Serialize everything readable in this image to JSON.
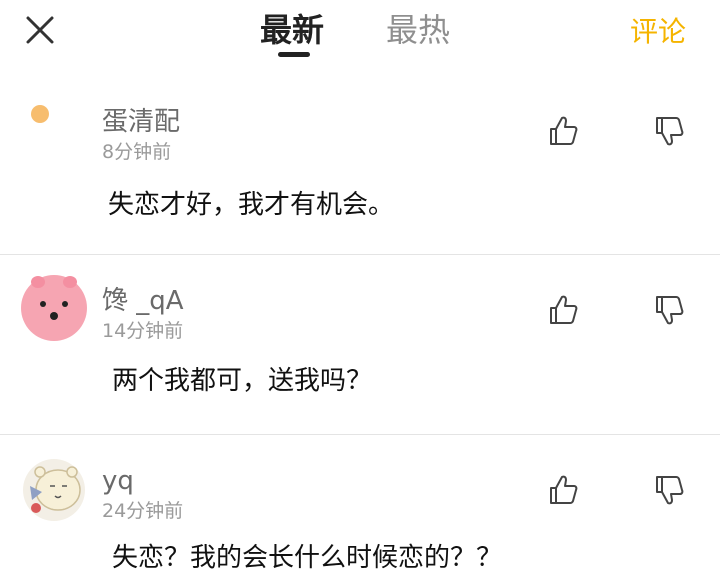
{
  "header": {
    "tabs": [
      {
        "label": "最新",
        "active": true
      },
      {
        "label": "最热",
        "active": false
      }
    ],
    "comment_link": "评论",
    "accent_color": "#f5b400"
  },
  "comments": [
    {
      "username": "蛋清配",
      "time": "8分钟前",
      "text": "失恋才好，我才有机会。",
      "avatar": "orange-dot"
    },
    {
      "username": "馋 _qA",
      "time": "14分钟前",
      "text": "两个我都可，送我吗？",
      "avatar": "pink-pig"
    },
    {
      "username": "yq",
      "time": "24分钟前",
      "text": "失恋？我的会长什么时候恋的？？",
      "avatar": "cartoon-bear"
    }
  ]
}
